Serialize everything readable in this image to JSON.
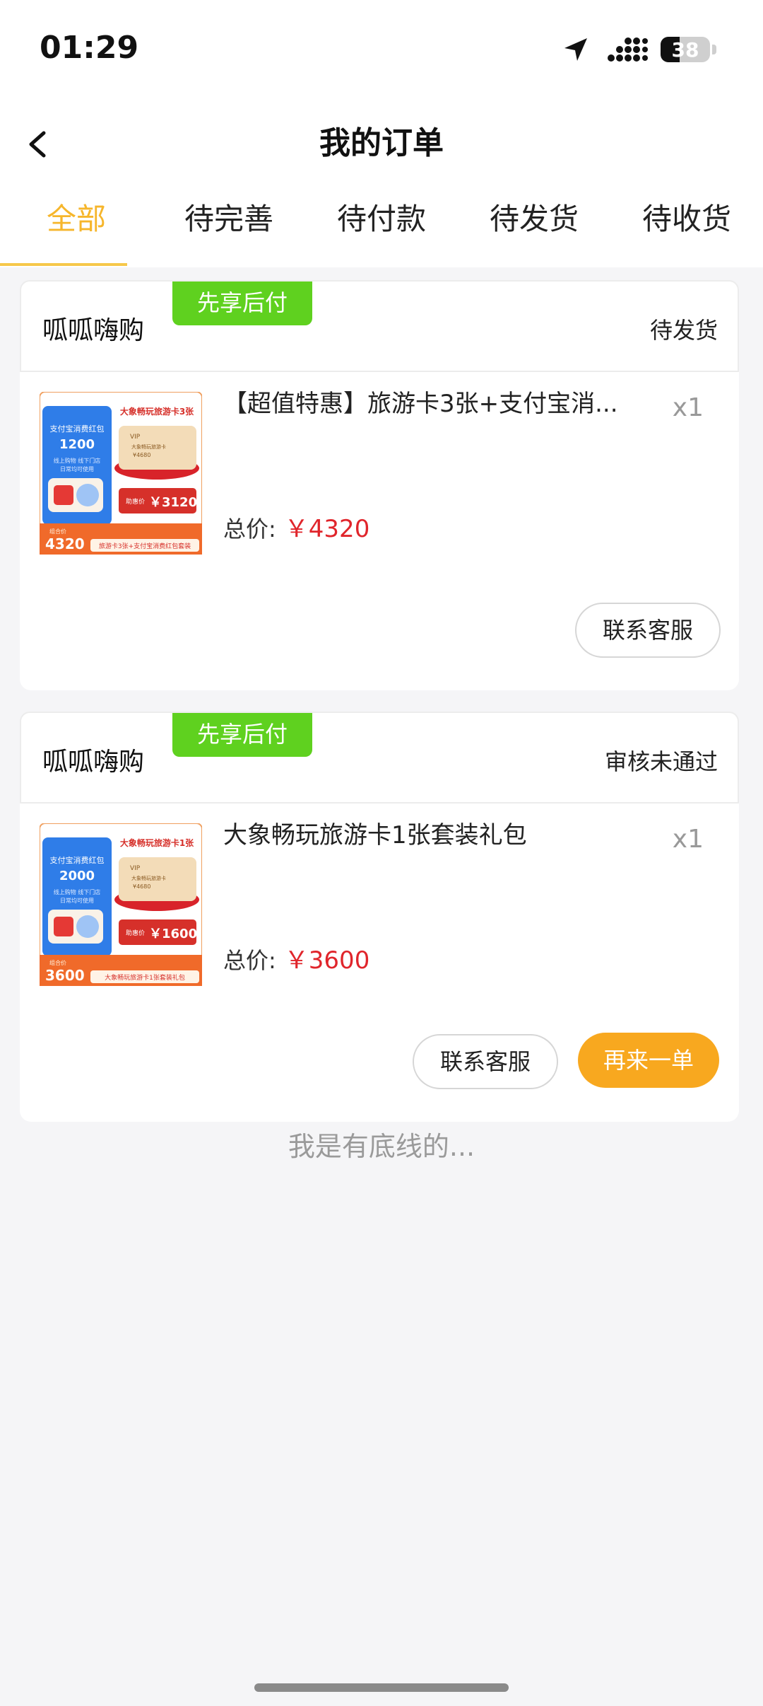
{
  "status_bar": {
    "time": "01:29",
    "battery": "38",
    "battery_level": 0.38
  },
  "header": {
    "title": "我的订单"
  },
  "tabs": [
    {
      "label": "全部"
    },
    {
      "label": "待完善"
    },
    {
      "label": "待付款"
    },
    {
      "label": "待发货"
    },
    {
      "label": "待收货"
    }
  ],
  "active_tab": "全部",
  "colors": {
    "accent": "#f6b62c",
    "badge": "#5fd11f",
    "price": "#e0252b",
    "primary_button": "#f8a81f"
  },
  "orders": [
    {
      "shop": "呱呱嗨购",
      "badge": "先享后付",
      "status": "待发货",
      "product_title": "【超值特惠】旅游卡3张+支付宝消...",
      "quantity": "x1",
      "price_label": "总价:",
      "price": "￥4320",
      "thumb": {
        "brand": "大象畅玩旅游卡3张",
        "red_packet": "支付宝消费红包",
        "amount": "1200",
        "sub1": "线上购物 线下门店",
        "sub2": "日常均可使用",
        "vip": "VIP",
        "card_line": "大象畅玩旅游卡",
        "card_price": "¥4680",
        "help_label": "助惠价",
        "help_price": "￥3120",
        "group_label": "组合价",
        "group_price": "4320",
        "footer": "旅游卡3张+支付宝消费红包套装"
      },
      "buttons": {
        "contact": "联系客服"
      }
    },
    {
      "shop": "呱呱嗨购",
      "badge": "先享后付",
      "status": "审核未通过",
      "product_title": "大象畅玩旅游卡1张套装礼包",
      "quantity": "x1",
      "price_label": "总价:",
      "price": "￥3600",
      "thumb": {
        "brand": "大象畅玩旅游卡1张",
        "red_packet": "支付宝消费红包",
        "amount": "2000",
        "sub1": "线上购物 线下门店",
        "sub2": "日常均可使用",
        "vip": "VIP",
        "card_line": "大象畅玩旅游卡",
        "card_price": "¥4680",
        "help_label": "助惠价",
        "help_price": "￥1600",
        "group_label": "组合价",
        "group_price": "3600",
        "footer": "大象畅玩旅游卡1张套装礼包"
      },
      "buttons": {
        "contact": "联系客服",
        "reorder": "再来一单"
      }
    }
  ],
  "footer_note": "我是有底线的..."
}
